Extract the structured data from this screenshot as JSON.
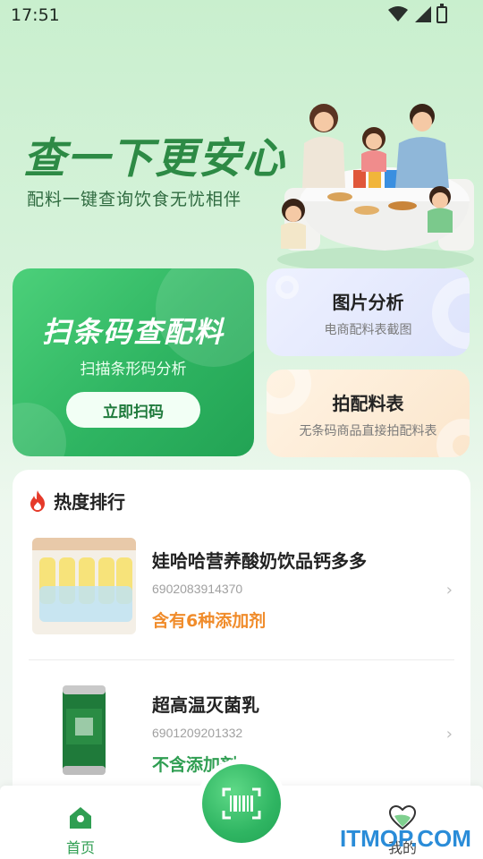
{
  "status_bar": {
    "time": "17:51"
  },
  "hero": {
    "title": "查一下更安心",
    "subtitle": "配料一键查询饮食无忧相伴"
  },
  "scan_card": {
    "title": "扫条码查配料",
    "subtitle": "扫描条形码分析",
    "button_label": "立即扫码"
  },
  "image_card": {
    "title": "图片分析",
    "subtitle": "电商配料表截图"
  },
  "photo_card": {
    "title": "拍配料表",
    "subtitle": "无条码商品直接拍配料表"
  },
  "ranking": {
    "title": "热度排行",
    "items": [
      {
        "name": "娃哈哈营养酸奶饮品钙多多",
        "code": "6902083914370",
        "tag": "含有6种添加剂"
      },
      {
        "name": "超高温灭菌乳",
        "code": "6901209201332",
        "tag": "不含添加剂"
      }
    ]
  },
  "bottom_nav": {
    "home_label": "首页",
    "mine_label": "我的"
  },
  "watermark": "ITMOP.COM",
  "colors": {
    "brand_green": "#2fb562",
    "warning_orange": "#f08c2b"
  }
}
